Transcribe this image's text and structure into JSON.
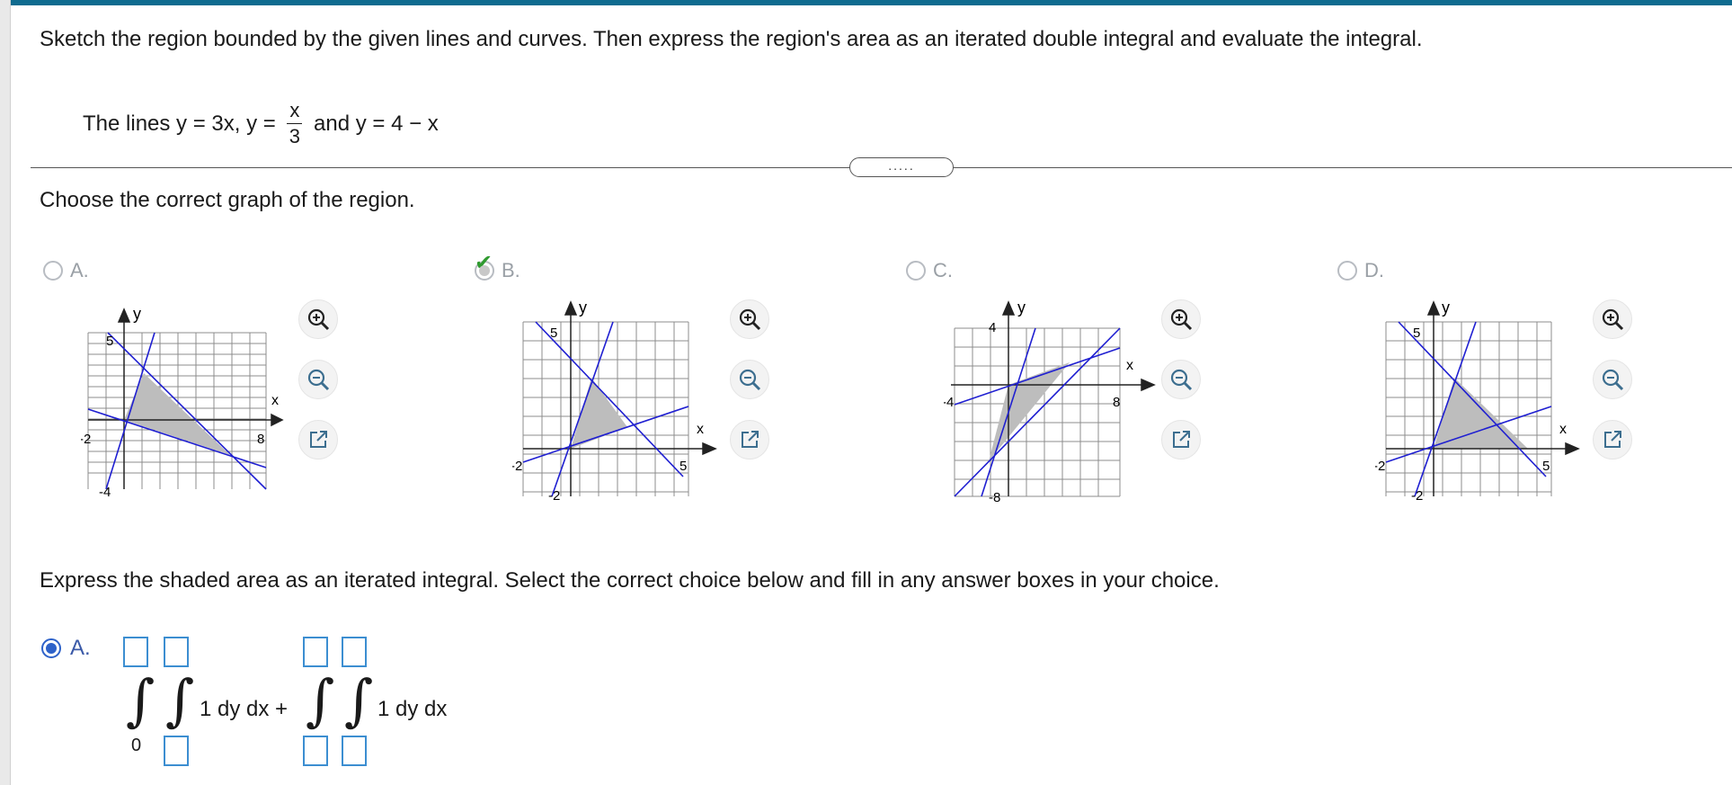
{
  "question": {
    "instruction": "Sketch the region bounded by the given lines and curves. Then express the region's area as an iterated double integral and evaluate the integral.",
    "lines_prefix": "The lines y = 3x, y =",
    "frac_num": "x",
    "frac_den": "3",
    "lines_suffix": "and y = 4 − x"
  },
  "more_button": ".....",
  "part1": {
    "prompt": "Choose the correct graph of the region.",
    "options": [
      {
        "label": "A.",
        "selected": false,
        "correct_mark": false
      },
      {
        "label": "B.",
        "selected": true,
        "correct_mark": true
      },
      {
        "label": "C.",
        "selected": false,
        "correct_mark": false
      },
      {
        "label": "D.",
        "selected": false,
        "correct_mark": false
      }
    ],
    "graphs": [
      {
        "axis_y": "y",
        "axis_x": "x",
        "t_top": "5",
        "t_right": "8",
        "t_left": "-2",
        "t_bottom": "-4"
      },
      {
        "axis_y": "y",
        "axis_x": "x",
        "t_top": "5",
        "t_right": "5",
        "t_left": "-2",
        "t_bottom": "-2"
      },
      {
        "axis_y": "y",
        "axis_x": "x",
        "t_top": "4",
        "t_right": "8",
        "t_left": "-4",
        "t_bottom": "-8"
      },
      {
        "axis_y": "y",
        "axis_x": "x",
        "t_top": "5",
        "t_right": "5",
        "t_left": "-2",
        "t_bottom": "-2"
      }
    ],
    "tools": [
      "zoom-in-icon",
      "zoom-out-icon",
      "open-window-icon"
    ]
  },
  "part2": {
    "prompt": "Express the shaded area as an iterated integral. Select the correct choice below and fill in any answer boxes in your choice.",
    "option_label": "A.",
    "lower_limit_1": "0",
    "integrand_1": "1 dy dx +",
    "integrand_2": "1 dy dx"
  },
  "colors": {
    "accent": "#0f6b8f",
    "line": "#1f1fd1",
    "shade": "#bdbdbd",
    "box": "#3c8ed1",
    "check": "#2f9a2f"
  }
}
